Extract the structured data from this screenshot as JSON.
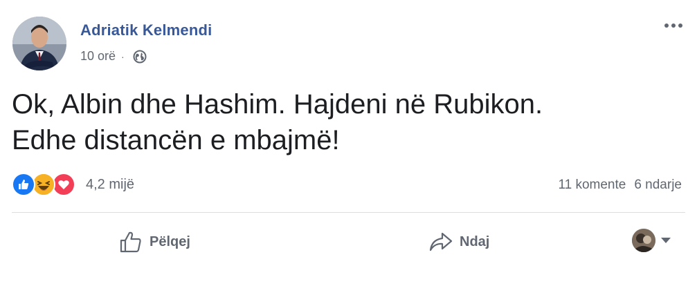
{
  "author": {
    "name": "Adriatik Kelmendi",
    "time": "10 orë",
    "separator": "·",
    "privacy_icon": "globe-icon"
  },
  "post": {
    "line1": "Ok, Albin dhe Hashim. Hajdeni në Rubikon.",
    "line2": "Edhe distancën e mbajmë!"
  },
  "reactions": {
    "icons": [
      "like-icon",
      "haha-icon",
      "love-icon"
    ],
    "count": "4,2 mijë"
  },
  "stats": {
    "comments": "11 komente",
    "shares": "6 ndarje"
  },
  "actions": {
    "like_label": "Pëlqej",
    "share_label": "Ndaj"
  },
  "colors": {
    "name": "#385898",
    "like": "#1877f2",
    "haha": "#f7b125",
    "love": "#f33e58",
    "muted": "#606770"
  }
}
